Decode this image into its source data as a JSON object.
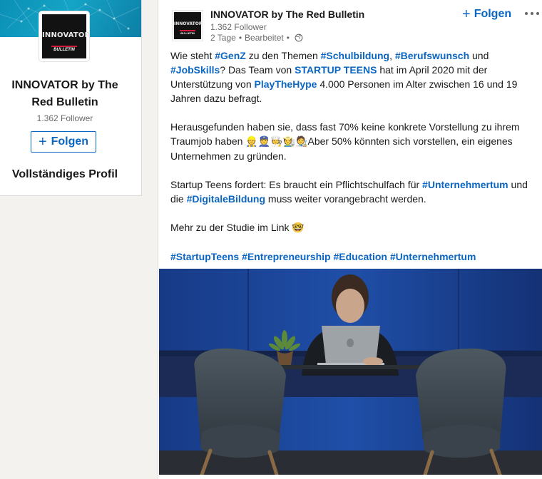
{
  "profile": {
    "logo_text": "INNOVATOR",
    "logo_subtext": "BULLETIN",
    "name": "INNOVATOR by The Red Bulletin",
    "followers": "1.362 Follower",
    "follow_label": "Folgen",
    "full_profile_label": "Vollständiges Profil"
  },
  "post": {
    "author": "INNOVATOR by The Red Bulletin",
    "followers": "1.362 Follower",
    "time": "2 Tage",
    "edited": "Bearbeitet",
    "follow_label": "Folgen",
    "paragraph1": {
      "t1": "Wie steht ",
      "tag1": "#GenZ",
      "t2": " zu den Themen ",
      "tag2": "#Schulbildung",
      "t3": ", ",
      "tag3": "#Berufswunsch",
      "t4": " und ",
      "tag4": "#JobSkills",
      "t5": "? Das Team von ",
      "tag5": "STARTUP TEENS",
      "t6": " hat im April 2020 mit der Unterstützung von ",
      "tag6": "PlayTheHype",
      "t7": " 4.000 Personen im Alter zwischen 16 und 19 Jahren dazu befragt."
    },
    "paragraph2": {
      "t1": "Herausgefunden haben sie, dass fast 70% keine konkrete Vorstellung zu ihrem Traumjob haben ",
      "emojis": "👷👮🧑‍🍳🧑‍🌾🧑‍🎨",
      "t2": "Aber 50% könnten sich vorstellen, ein eigenes Unternehmen zu gründen."
    },
    "paragraph3": {
      "t1": "Startup Teens fordert: Es braucht ein Pflichtschulfach für ",
      "tag1": "#Unternehmertum",
      "t2": " und die ",
      "tag2": "#DigitaleBildung",
      "t3": " muss weiter vorangebracht werden."
    },
    "paragraph4": {
      "t1": "Mehr zu der Studie im Link ",
      "emoji": "🤓"
    },
    "hashtags": {
      "h1": "#StartupTeens",
      "h2": "#Entrepreneurship",
      "h3": "#Education",
      "h4": "#Unternehmertum"
    }
  },
  "colors": {
    "link": "#0a66c2",
    "brand_red": "#d31a3b",
    "background": "#f3f2ef"
  }
}
